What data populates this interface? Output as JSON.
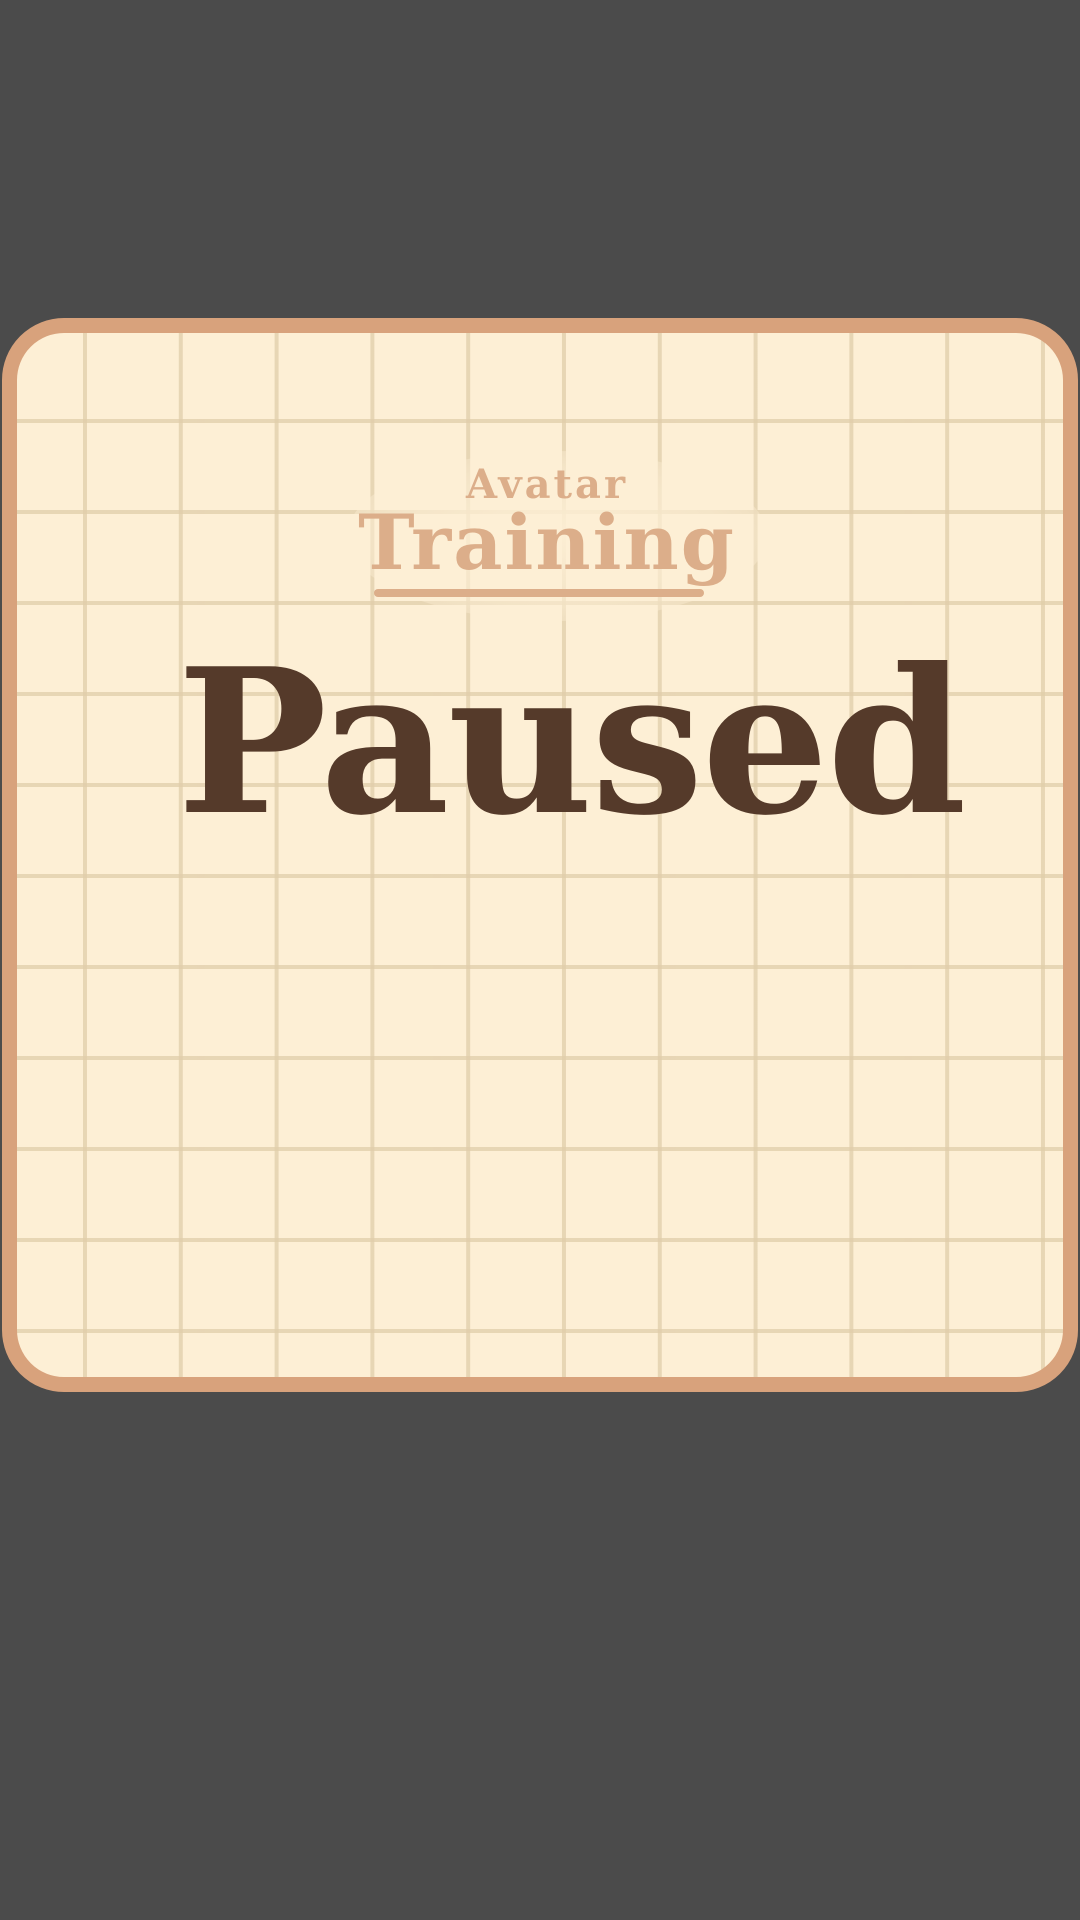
{
  "game": {
    "title_line1": "Avatar",
    "title_line2": "Training"
  },
  "pause_screen": {
    "status_text": "Paused"
  },
  "colors": {
    "background": "#4b4b4b",
    "panel_border": "#d8a27c",
    "panel_fill": "#fdefd5",
    "grid_lines": "#e3d0ac",
    "title_color": "#dcae8a",
    "paused_text_color": "#553a2a"
  }
}
